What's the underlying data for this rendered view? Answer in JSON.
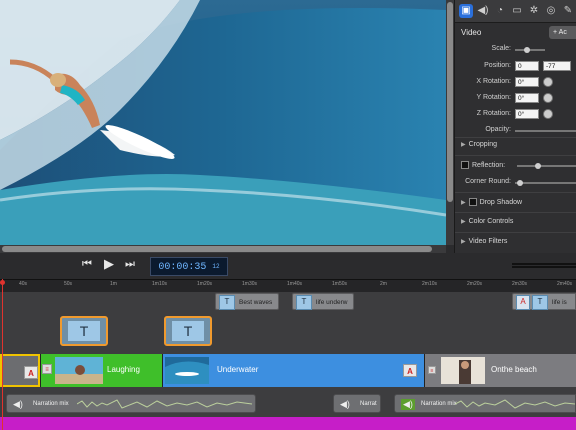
{
  "inspector": {
    "tab_icons": [
      "video-icon",
      "audio-icon",
      "speed-icon",
      "screen-icon",
      "filter-icon",
      "transition-icon",
      "annotation-icon"
    ],
    "section_title": "Video",
    "add_button": "+ Ac",
    "scale_label": "Scale:",
    "position_label": "Position:",
    "position_x": "0",
    "position_y": "-77",
    "x_rotation_label": "X Rotation:",
    "x_rotation": "0°",
    "y_rotation_label": "Y Rotation:",
    "y_rotation": "0°",
    "z_rotation_label": "Z Rotation:",
    "z_rotation": "0°",
    "opacity_label": "Opacity:",
    "cropping": "Cropping",
    "reflection": "Reflection:",
    "corner_round": "Corner Round:",
    "drop_shadow": "Drop Shadow",
    "color_controls": "Color Controls",
    "video_filters": "Video Filters",
    "accent_color": "#2a6fdb"
  },
  "transport": {
    "rewind_icon": "rewind-icon",
    "play_icon": "play-icon",
    "forward_icon": "fast-forward-icon",
    "timecode_main": "00:00:35",
    "timecode_frames": "12"
  },
  "ruler": {
    "ticks": [
      "40s",
      "50s",
      "1m",
      "1m10s",
      "1m20s",
      "1m30s",
      "1m40s",
      "1m50s",
      "2m",
      "2m10s",
      "2m20s",
      "2m30s",
      "2m40s"
    ]
  },
  "timeline": {
    "titles": [
      {
        "label": "Best waves"
      },
      {
        "label": "life underw"
      },
      {
        "label": "life is"
      }
    ],
    "clips": [
      {
        "label": "Laughing",
        "color": "#3fbf2a"
      },
      {
        "label": "Underwater",
        "color": "#3d8fe0"
      },
      {
        "label": "Onthe beach",
        "color": "#7c7c80"
      }
    ],
    "audio": [
      {
        "label": "Narration mix"
      },
      {
        "label": "Narrat"
      },
      {
        "label": "Narration mix"
      }
    ],
    "playhead_color": "#e0332e",
    "selection_color": "#f0c300"
  }
}
